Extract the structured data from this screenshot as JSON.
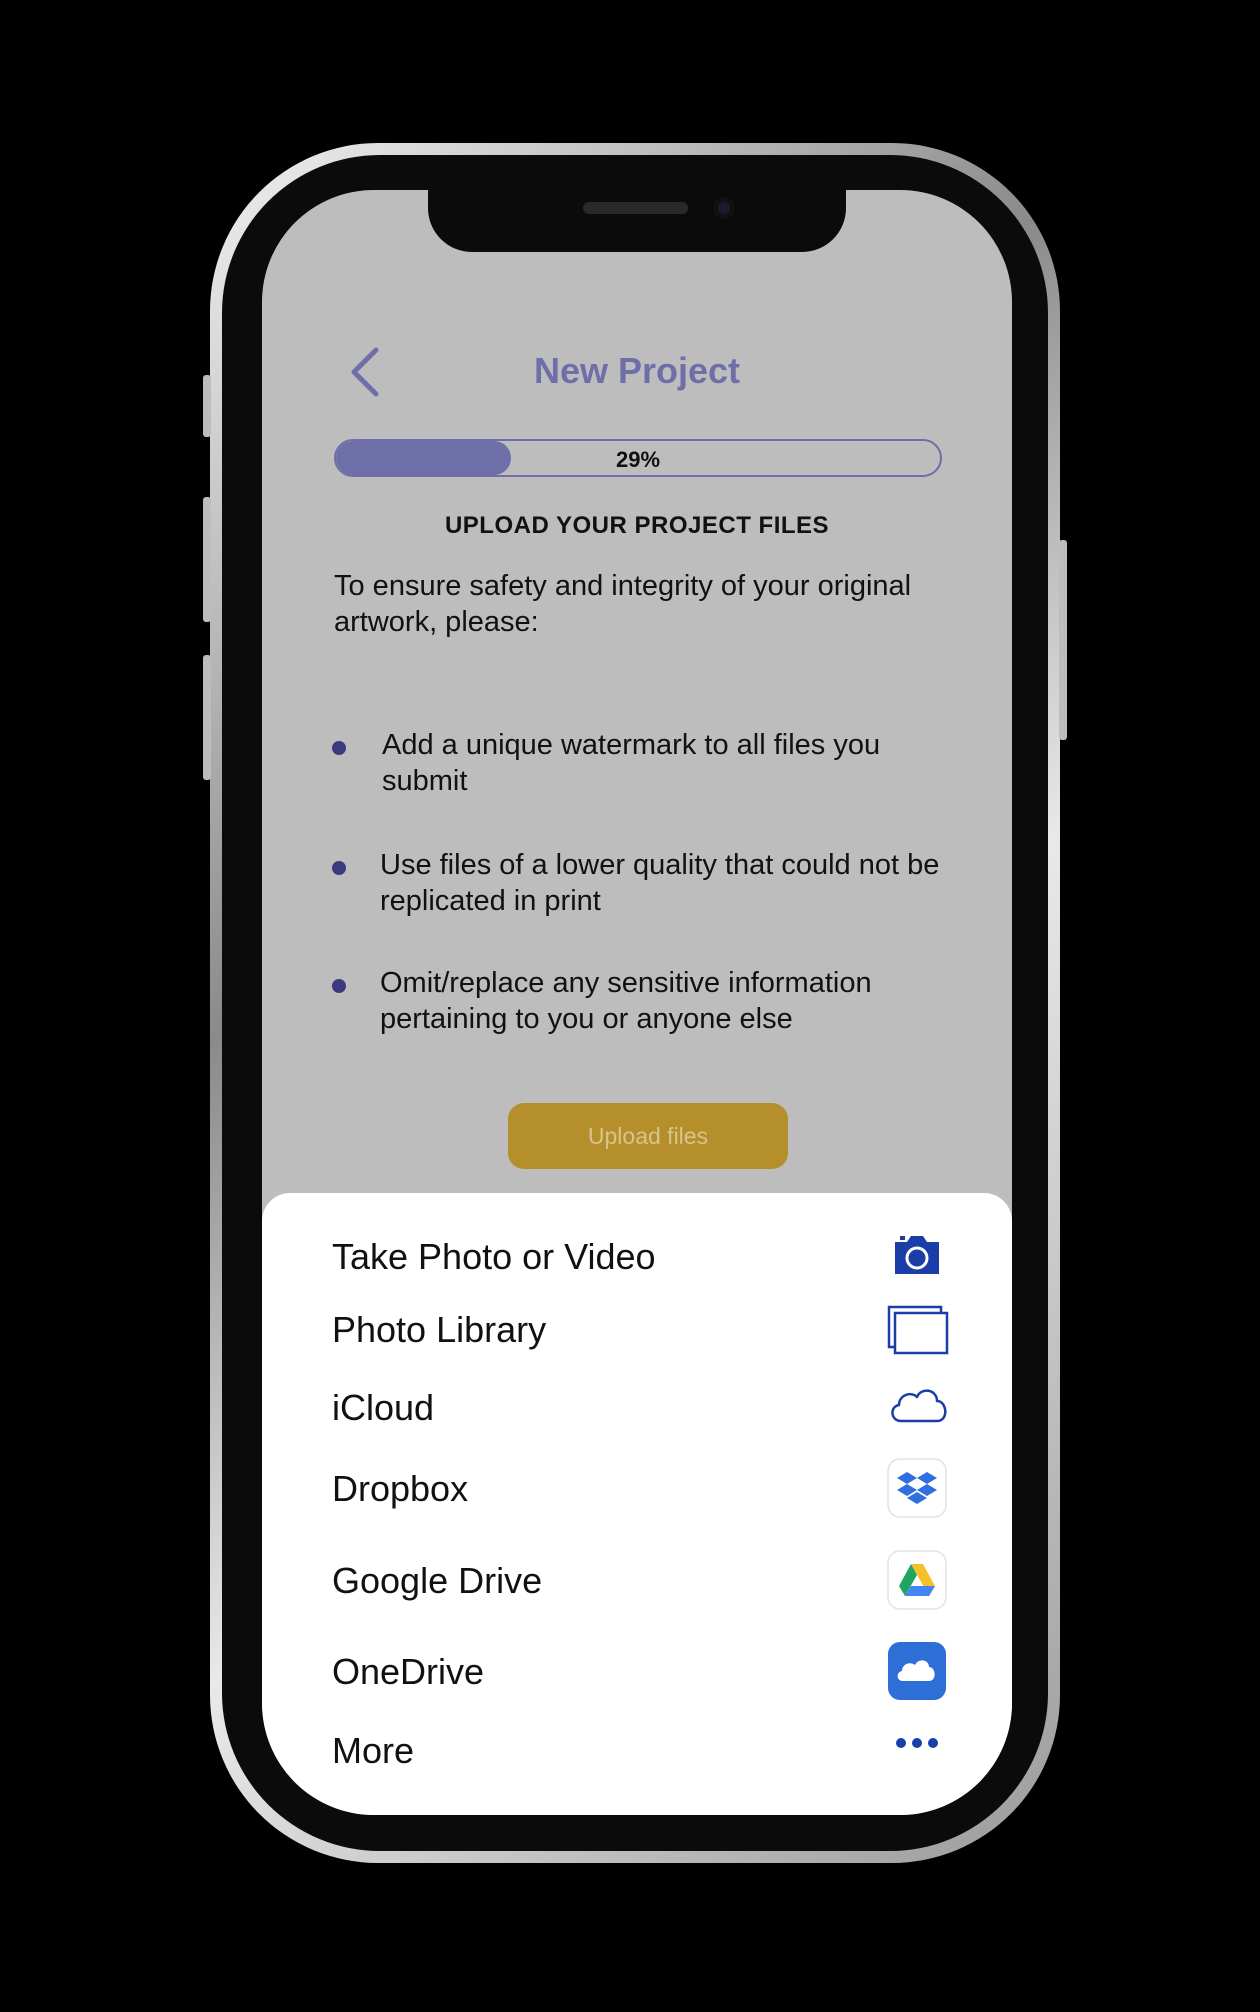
{
  "header": {
    "title": "New Project"
  },
  "progress": {
    "value": 0.29,
    "label": "29%"
  },
  "section_title": "UPLOAD YOUR PROJECT FILES",
  "intro": "To ensure safety and integrity of your original artwork, please:",
  "bullets": [
    "Add a unique watermark to all files you submit",
    "Use files of a lower quality that could not be replicated in print",
    "Omit/replace any sensitive information pertaining to you or anyone else"
  ],
  "upload_button": "Upload files",
  "sheet": {
    "options": [
      {
        "label": "Take Photo or Video",
        "icon": "camera-icon"
      },
      {
        "label": "Photo Library",
        "icon": "photo-library-icon"
      },
      {
        "label": "iCloud",
        "icon": "icloud-icon"
      },
      {
        "label": "Dropbox",
        "icon": "dropbox-icon"
      },
      {
        "label": "Google Drive",
        "icon": "google-drive-icon"
      },
      {
        "label": "OneDrive",
        "icon": "onedrive-icon"
      },
      {
        "label": "More",
        "icon": "more-icon"
      }
    ]
  },
  "colors": {
    "accent": "#6e6fa8",
    "button": "#b58f2b",
    "icon_blue": "#1a3da8",
    "bullet": "#3a3a7d"
  }
}
